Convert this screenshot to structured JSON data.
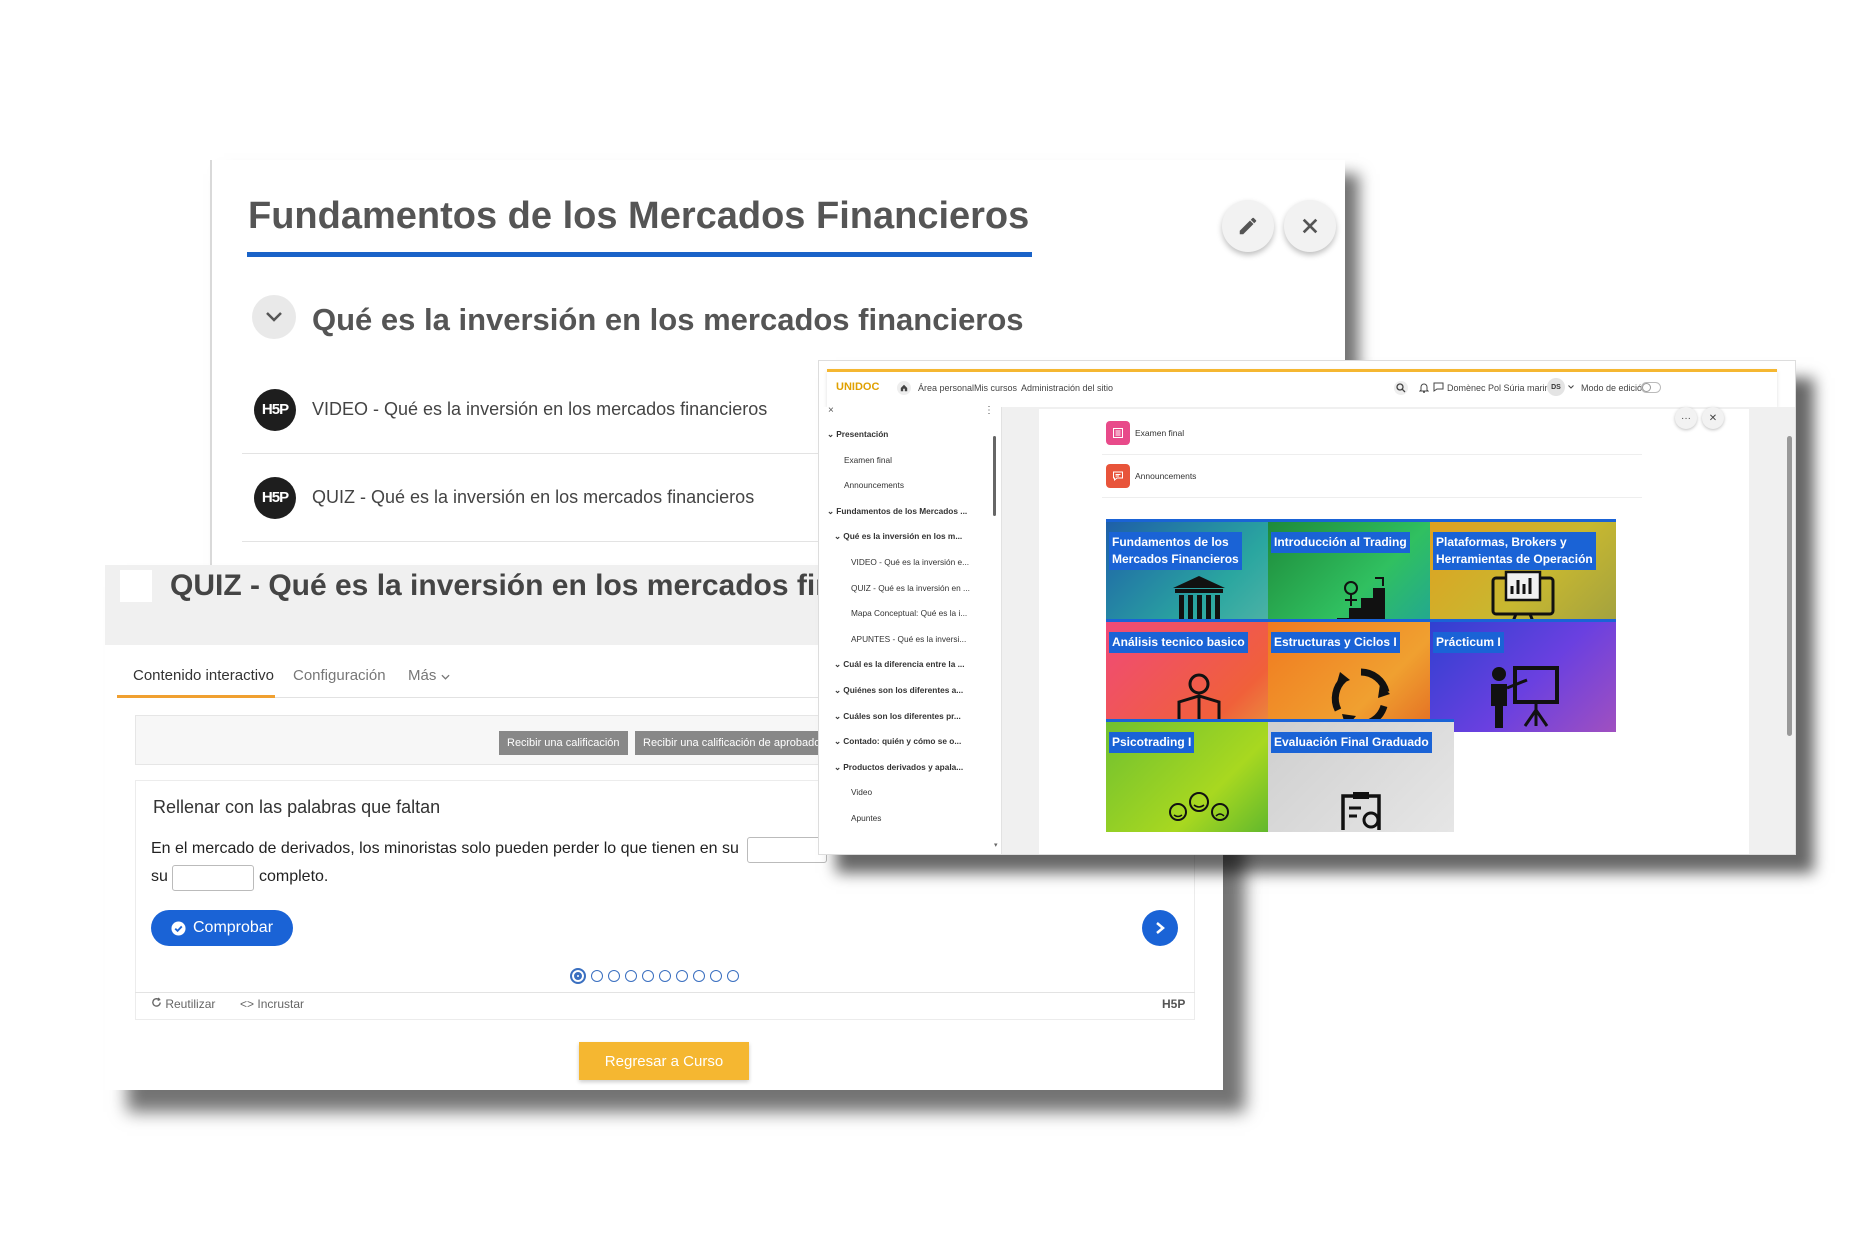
{
  "course_panel": {
    "title": "Fundamentos de los Mercados Financieros",
    "edit_icon": "pencil-icon",
    "close_icon": "close-icon",
    "section_title": "Qué es la inversión en los mercados financieros",
    "activities": [
      {
        "badge": "H5P",
        "prefix": "VIDEO",
        "text": " - Qué es la inversión en los mercados financieros"
      },
      {
        "badge": "H5P",
        "prefix": "QUIZ",
        "text": " - Qué es la inversión en los mercados financieros"
      }
    ]
  },
  "quiz_panel": {
    "title": "QUIZ - Qué es la inversión en los mercados financieros",
    "tabs": [
      "Contenido interactivo",
      "Configuración",
      "Más"
    ],
    "grade_buttons": [
      "Recibir una calificación",
      "Recibir una calificación de aprobado"
    ],
    "question_title": "Rellenar con las palabras que faltan",
    "question_line1": "En el mercado de derivados, los minoristas solo pueden perder lo que tienen en su",
    "question_su": "su",
    "question_completo": "completo.",
    "check_label": "Comprobar",
    "dots_total": 10,
    "dots_current": 1,
    "reuse_label": "Reutilizar",
    "embed_label": "Incrustar",
    "h5p_mark": "H5P",
    "back_label": "Regresar a Curso"
  },
  "moodle": {
    "logo": "UNIDOC",
    "nav": [
      "Área personal",
      "Mis cursos",
      "Administración del sitio"
    ],
    "user_name": "Domènec Pol Súria marin",
    "user_initials": "DS",
    "edit_mode": "Modo de edición",
    "sidebar": [
      {
        "label": "Presentación",
        "bold": true,
        "chev": true,
        "indent": 0
      },
      {
        "label": "Examen final",
        "bold": false,
        "chev": false,
        "indent": 1
      },
      {
        "label": "Announcements",
        "bold": false,
        "chev": false,
        "indent": 1
      },
      {
        "label": "Fundamentos de los Mercados ...",
        "bold": true,
        "chev": true,
        "indent": 0
      },
      {
        "label": "Qué es la inversión en los m...",
        "bold": true,
        "chev": true,
        "indent": 1
      },
      {
        "label": "VIDEO - Qué es la inversión e...",
        "bold": false,
        "chev": false,
        "indent": 2
      },
      {
        "label": "QUIZ - Qué es la inversión en ...",
        "bold": false,
        "chev": false,
        "indent": 2
      },
      {
        "label": "Mapa Conceptual: Qué es la i...",
        "bold": false,
        "chev": false,
        "indent": 2
      },
      {
        "label": "APUNTES - Qué es la inversi...",
        "bold": false,
        "chev": false,
        "indent": 2
      },
      {
        "label": "Cuál es la diferencia entre la ...",
        "bold": true,
        "chev": true,
        "indent": 1
      },
      {
        "label": "Quiénes son los diferentes a...",
        "bold": true,
        "chev": true,
        "indent": 1
      },
      {
        "label": "Cuáles son los diferentes pr...",
        "bold": true,
        "chev": true,
        "indent": 1
      },
      {
        "label": "Contado: quién y cómo se o...",
        "bold": true,
        "chev": true,
        "indent": 1
      },
      {
        "label": "Productos derivados y apala...",
        "bold": true,
        "chev": true,
        "indent": 1
      },
      {
        "label": "Video",
        "bold": false,
        "chev": false,
        "indent": 2
      },
      {
        "label": "Apuntes",
        "bold": false,
        "chev": false,
        "indent": 2
      }
    ],
    "main_items": [
      {
        "label": "Examen final",
        "color": "#e84a8a",
        "icon": "quiz-icon"
      },
      {
        "label": "Announcements",
        "color": "#e8543a",
        "icon": "forum-icon"
      }
    ],
    "tiles": [
      {
        "label1": "Fundamentos de los",
        "label2": "Mercados Financieros",
        "bg": "linear-gradient(135deg,#1e5fa8,#2aa6a0 60%,#5ab7a8)",
        "icon": "bank-icon"
      },
      {
        "label1": "Introducción al Trading",
        "label2": "",
        "bg": "linear-gradient(135deg,#1e8a3a,#30c060 55%,#1ea0a0)",
        "icon": "stairs-icon"
      },
      {
        "label1": "Plataformas, Brokers y",
        "label2": "Herramientas de Operación",
        "bg": "linear-gradient(135deg,#e0a020,#c8b830 55%,#a0a040)",
        "icon": "computer-icon"
      },
      {
        "label1": "Análisis tecnico basico",
        "label2": "",
        "bg": "linear-gradient(135deg,#f04a78,#f0603a 70%,#e8a040)",
        "icon": "reader-icon"
      },
      {
        "label1": "Estructuras y Ciclos I",
        "label2": "",
        "bg": "linear-gradient(135deg,#f07a20,#f0a030 60%,#e06020)",
        "icon": "cycle-icon"
      },
      {
        "label1": "Prácticum I",
        "label2": "",
        "bg": "linear-gradient(135deg,#3040d0,#6a40e0 55%,#a050c0)",
        "icon": "presenter-icon"
      },
      {
        "label1": "Psicotrading I",
        "label2": "",
        "bg": "linear-gradient(135deg,#70c030,#a8d820 60%,#50b030)",
        "icon": "emotions-icon"
      },
      {
        "label1": "Evaluación Final Graduado",
        "label2": "",
        "bg": "linear-gradient(135deg,#cfcfcf,#e6e6e6)",
        "icon": "clipboard-icon"
      }
    ]
  }
}
